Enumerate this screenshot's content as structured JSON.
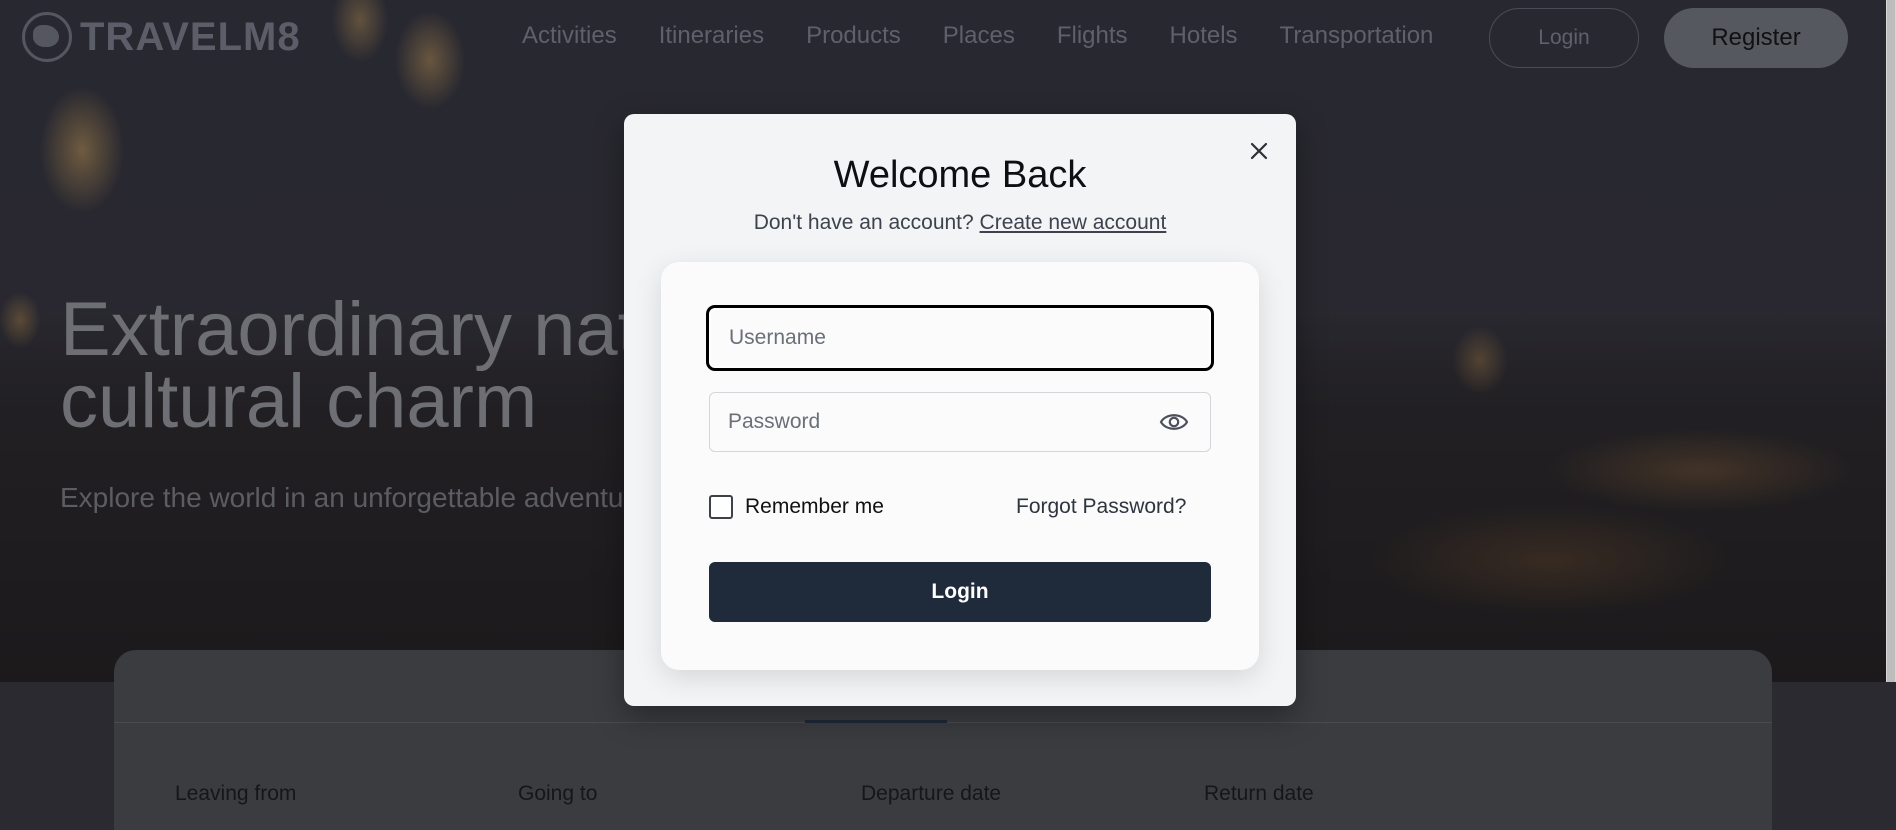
{
  "header": {
    "logo_text": "TRAVELM8",
    "nav": [
      "Activities",
      "Itineraries",
      "Products",
      "Places",
      "Flights",
      "Hotels",
      "Transportation"
    ],
    "login_label": "Login",
    "register_label": "Register"
  },
  "hero": {
    "title": "Extraordinary natural and cultural charm",
    "subtitle": "Explore the world in an unforgettable adventure"
  },
  "search": {
    "fields": [
      "Leaving from",
      "Going to",
      "Departure date",
      "Return date"
    ]
  },
  "modal": {
    "title": "Welcome Back",
    "subtitle_prefix": "Don't have an account?",
    "create_account_link": "Create new account",
    "username_placeholder": "Username",
    "password_placeholder": "Password",
    "remember_label": "Remember me",
    "forgot_label": "Forgot Password?",
    "submit_label": "Login"
  },
  "colors": {
    "primary_button": "#1f2a3b",
    "modal_bg": "#f3f4f6"
  }
}
